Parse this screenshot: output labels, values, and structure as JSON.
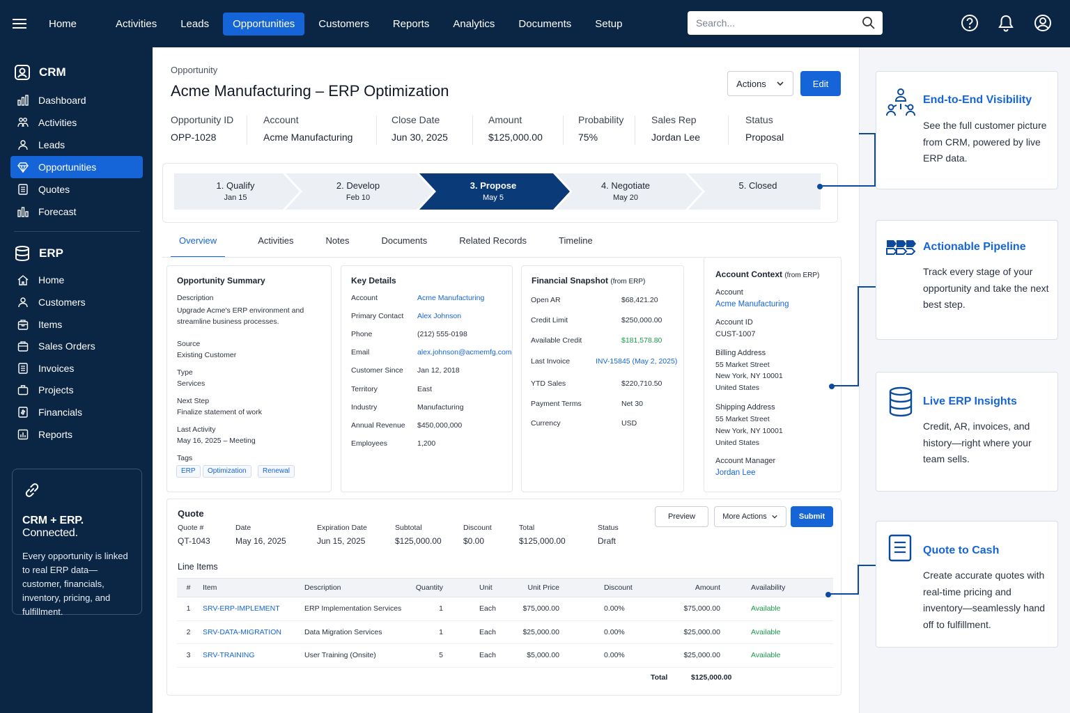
{
  "topnav": {
    "items": [
      "Home",
      "Activities",
      "Leads",
      "Opportunities",
      "Customers",
      "Reports",
      "Analytics",
      "Documents",
      "Setup"
    ],
    "search_placeholder": "Search..."
  },
  "sidebar": {
    "crm_title": "CRM",
    "crm_items": [
      "Dashboard",
      "Activities",
      "Leads",
      "Opportunities",
      "Quotes",
      "Forecast"
    ],
    "erp_title": "ERP",
    "erp_items": [
      "Home",
      "Customers",
      "Items",
      "Sales Orders",
      "Invoices",
      "Projects",
      "Financials",
      "Reports"
    ],
    "promo": {
      "title_a": "CRM + ERP.",
      "title_b": "Connected.",
      "text": "Every opportunity is linked to real ERP data—customer, financials, inventory, pricing, and fulfillment."
    }
  },
  "header": {
    "breadcrumb": "Opportunity",
    "title": "Acme Manufacturing – ERP Optimization",
    "actions_label": "Actions",
    "edit_label": "Edit"
  },
  "fields": [
    {
      "label": "Opportunity ID",
      "value": "OPP-1028"
    },
    {
      "label": "Account",
      "value": "Acme Manufacturing"
    },
    {
      "label": "Close Date",
      "value": "Jun 30, 2025"
    },
    {
      "label": "Amount",
      "value": "$125,000.00"
    },
    {
      "label": "Probability",
      "value": "75%"
    },
    {
      "label": "Sales Rep",
      "value": "Jordan Lee"
    },
    {
      "label": "Status",
      "value": "Proposal"
    }
  ],
  "stages": [
    {
      "name": "1. Qualify",
      "date": "Jan 15"
    },
    {
      "name": "2. Develop",
      "date": "Feb 10"
    },
    {
      "name": "3. Propose",
      "date": "May 5"
    },
    {
      "name": "4. Negotiate",
      "date": "May 20"
    },
    {
      "name": "5. Closed",
      "date": ""
    }
  ],
  "tabs": [
    "Overview",
    "Activities",
    "Notes",
    "Documents",
    "Related Records",
    "Timeline"
  ],
  "summary": {
    "title": "Opportunity Summary",
    "desc_label": "Description",
    "desc": "Upgrade Acme's ERP environment and streamline business processes.",
    "source_label": "Source",
    "source": "Existing Customer",
    "type_label": "Type",
    "type": "Services",
    "next_label": "Next Step",
    "next": "Finalize statement of work",
    "last_label": "Last Activity",
    "last": "May 16, 2025 – Meeting",
    "tags_label": "Tags",
    "tags": [
      "ERP",
      "Optimization",
      "Renewal"
    ]
  },
  "key_details": {
    "title": "Key Details",
    "rows": [
      {
        "k": "Account",
        "v": "Acme Manufacturing"
      },
      {
        "k": "Primary Contact",
        "v": "Alex Johnson"
      },
      {
        "k": "Phone",
        "v": "(212) 555-0198"
      },
      {
        "k": "Email",
        "v": "alex.johnson@acmemfg.com"
      },
      {
        "k": "Customer Since",
        "v": "Jan 12, 2018"
      },
      {
        "k": "Territory",
        "v": "East"
      },
      {
        "k": "Industry",
        "v": "Manufacturing"
      },
      {
        "k": "Annual Revenue",
        "v": "$450,000,000"
      },
      {
        "k": "Employees",
        "v": "1,200"
      }
    ]
  },
  "financial": {
    "title": "Financial Snapshot",
    "title_sub": "(from ERP)",
    "rows": [
      {
        "k": "Open AR",
        "v": "$68,421.20"
      },
      {
        "k": "Credit Limit",
        "v": "$250,000.00"
      },
      {
        "k": "Available Credit",
        "v": "$181,578.80"
      },
      {
        "k": "Last Invoice",
        "v": "INV-15845 (May 2, 2025)"
      },
      {
        "k": "YTD Sales",
        "v": "$220,710.50"
      },
      {
        "k": "Payment Terms",
        "v": "Net 30"
      },
      {
        "k": "Currency",
        "v": "USD"
      }
    ]
  },
  "account_ctx": {
    "title": "Account Context",
    "title_sub": "(from ERP)",
    "account_label": "Account",
    "account": "Acme Manufacturing",
    "id_label": "Account ID",
    "id": "CUST-1007",
    "billing_label": "Billing Address",
    "billing": [
      "55 Market Street",
      "New York, NY 10001",
      "United States"
    ],
    "shipping_label": "Shipping Address",
    "shipping": [
      "55 Market Street",
      "New York, NY 10001",
      "United States"
    ],
    "manager_label": "Account Manager",
    "manager": "Jordan Lee"
  },
  "quote": {
    "title": "Quote",
    "preview_label": "Preview",
    "more_label": "More Actions",
    "submit_label": "Submit",
    "fields": [
      {
        "label": "Quote #",
        "value": "QT-1043"
      },
      {
        "label": "Date",
        "value": "May 16, 2025"
      },
      {
        "label": "Expiration Date",
        "value": "Jun 15, 2025"
      },
      {
        "label": "Subtotal",
        "value": "$125,000.00"
      },
      {
        "label": "Discount",
        "value": "$0.00"
      },
      {
        "label": "Total",
        "value": "$125,000.00"
      },
      {
        "label": "Status",
        "value": "Draft"
      }
    ],
    "line_items_title": "Line Items",
    "columns": [
      "#",
      "Item",
      "Description",
      "Quantity",
      "Unit",
      "Unit Price",
      "Discount",
      "Amount",
      "Availability"
    ],
    "rows": [
      [
        "1",
        "SRV-ERP-IMPLEMENT",
        "ERP Implementation Services",
        "1",
        "Each",
        "$75,000.00",
        "0.00%",
        "$75,000.00",
        "Available"
      ],
      [
        "2",
        "SRV-DATA-MIGRATION",
        "Data Migration Services",
        "1",
        "Each",
        "$25,000.00",
        "0.00%",
        "$25,000.00",
        "Available"
      ],
      [
        "3",
        "SRV-TRAINING",
        "User Training (Onsite)",
        "5",
        "Each",
        "$5,000.00",
        "0.00%",
        "$25,000.00",
        "Available"
      ]
    ],
    "total_label": "Total",
    "total_value": "$125,000.00"
  },
  "features": [
    {
      "title": "End-to-End Visibility",
      "text": "See the full customer picture from CRM, powered by live ERP data.",
      "icon": "people-network-icon"
    },
    {
      "title": "Actionable Pipeline",
      "text": "Track every stage of your opportunity and take the next best step.",
      "icon": "pipeline-arrows-icon"
    },
    {
      "title": "Live ERP Insights",
      "text": "Credit, AR, invoices, and history—right where your team sells.",
      "icon": "database-icon"
    },
    {
      "title": "Quote to Cash",
      "text": "Create accurate quotes with real-time pricing and inventory—seamlessly hand off to fulfillment.",
      "icon": "document-icon"
    }
  ],
  "colors": {
    "navy": "#0b2545",
    "accent": "#1565d8",
    "available": "#1a9a4a"
  }
}
